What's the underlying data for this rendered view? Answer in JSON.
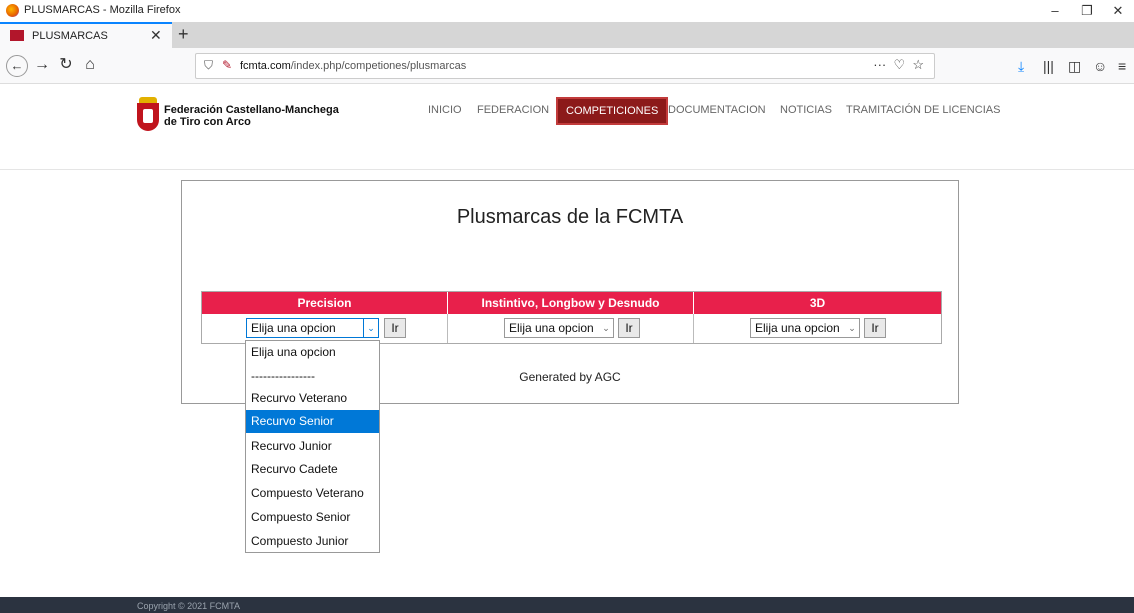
{
  "window": {
    "title": "PLUSMARCAS - Mozilla Firefox"
  },
  "tab": {
    "label": "PLUSMARCAS"
  },
  "url": {
    "domain": "fcmta.com",
    "path": "/index.php/competiones/plusmarcas"
  },
  "site": {
    "org_line1": "Federación Castellano-Manchega",
    "org_line2": "de Tiro con Arco",
    "menu": [
      "INICIO",
      "FEDERACION",
      "COMPETICIONES",
      "DOCUMENTACION",
      "NOTICIAS",
      "TRAMITACIÓN DE LICENCIAS"
    ],
    "active_menu": "COMPETICIONES"
  },
  "panel": {
    "title": "Plusmarcas de la FCMTA",
    "columns": [
      "Precision",
      "Instintivo, Longbow y Desnudo",
      "3D"
    ],
    "select_value": "Elija una opcion",
    "button_label": "Ir",
    "generated": "Generated by AGC"
  },
  "dropdown": {
    "options": [
      "Elija una opcion",
      "----------------",
      "Recurvo Veterano",
      "Recurvo Senior",
      "Recurvo Junior",
      "Recurvo Cadete",
      "Compuesto Veterano",
      "Compuesto Senior",
      "Compuesto Junior"
    ],
    "highlighted": "Recurvo Senior"
  },
  "footer": {
    "text": "Copyright © 2021 FCMTA"
  },
  "colors": {
    "header_red": "#e8204b",
    "active_menu": "#8c1a1a",
    "highlight": "#0078d7",
    "footer": "#2b3340"
  }
}
